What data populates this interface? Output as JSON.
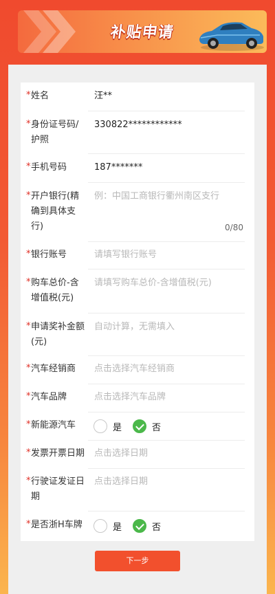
{
  "banner": {
    "title": "补贴申请"
  },
  "form": {
    "name": {
      "label": "姓名",
      "value": "汪**"
    },
    "id_number": {
      "label_line1": "身份证号码/",
      "label_line2": "护照",
      "value": "330822************"
    },
    "phone": {
      "label": "手机号码",
      "value": "187*******"
    },
    "bank": {
      "label_line1": "开户银行(精",
      "label_line2": "确到具体支",
      "label_line3": "行)",
      "placeholder": "例：中国工商银行衢州南区支行",
      "counter": "0/80"
    },
    "account": {
      "label": "银行账号",
      "placeholder": "请填写银行账号"
    },
    "price": {
      "label_line1": "购车总价-含",
      "label_line2": "增值税(元)",
      "placeholder": "请填写购车总价-含增值税(元)"
    },
    "subsidy": {
      "label_line1": "申请奖补金额",
      "label_line2": "(元)",
      "placeholder": "自动计算，无需填入"
    },
    "dealer": {
      "label": "汽车经销商",
      "placeholder": "点击选择汽车经销商"
    },
    "brand": {
      "label": "汽车品牌",
      "placeholder": "点击选择汽车品牌"
    },
    "new_energy": {
      "label": "新能源汽车",
      "yes": "是",
      "no": "否",
      "selected": "否"
    },
    "invoice_date": {
      "label": "发票开票日期",
      "placeholder": "点击选择日期"
    },
    "license_date": {
      "label_line1": "行驶证发证日",
      "label_line2": "期",
      "placeholder": "点击选择日期"
    },
    "zhe_h_plate": {
      "label": "是否浙H车牌",
      "yes": "是",
      "no": "否",
      "selected": "否"
    }
  },
  "star": "*",
  "next_button": "下一步",
  "colors": {
    "accent": "#f2502d",
    "required": "#e02e24",
    "checked": "#4bb84a"
  },
  "icons": {
    "car": "car-icon",
    "chevrons": "chevron-right-icon"
  }
}
